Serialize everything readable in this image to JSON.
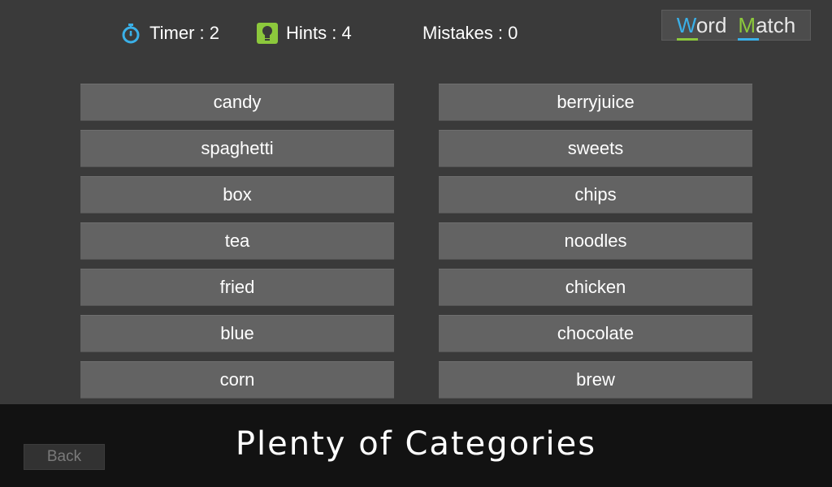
{
  "hud": {
    "timer_label": "Timer : 2",
    "hints_label": "Hints : 4",
    "mistakes_label": "Mistakes : 0",
    "timer_icon": "stopwatch-icon",
    "hints_icon": "lightbulb-icon"
  },
  "logo": {
    "word1_cap": "W",
    "word1_rest": "ord",
    "word2_cap": "M",
    "word2_rest": "atch"
  },
  "left_words": [
    "candy",
    "spaghetti",
    "box",
    "tea",
    "fried",
    "blue",
    "corn"
  ],
  "right_words": [
    "berryjuice",
    "sweets",
    "chips",
    "noodles",
    "chicken",
    "chocolate",
    "brew"
  ],
  "footer": {
    "back_label": "Back",
    "caption": "Plenty of Categories"
  },
  "colors": {
    "background": "#3a3a3a",
    "tile": "#636363",
    "footer": "#121212",
    "accent_blue": "#3ab0e8",
    "accent_green": "#8cc83c"
  }
}
